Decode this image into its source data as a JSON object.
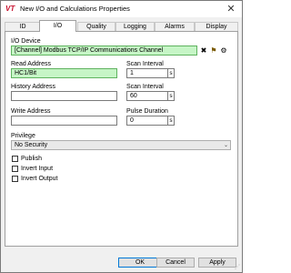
{
  "window": {
    "title": "New I/O and Calculations Properties",
    "app_icon": "VT"
  },
  "tabs": [
    {
      "label": "ID"
    },
    {
      "label": "I/O"
    },
    {
      "label": "Quality"
    },
    {
      "label": "Logging"
    },
    {
      "label": "Alarms"
    },
    {
      "label": "Display"
    }
  ],
  "io": {
    "device_label": "I/O Device",
    "device_value": "[Channel]    Modbus TCP/IP Communications Channel",
    "read_label": "Read Address",
    "read_value": "HC1/Bit",
    "scan1_label": "Scan Interval",
    "scan1_value": "1",
    "scan1_unit": "s",
    "history_label": "History Address",
    "history_value": "",
    "scan2_label": "Scan Interval",
    "scan2_value": "60",
    "scan2_unit": "s",
    "write_label": "Write Address",
    "write_value": "",
    "pulse_label": "Pulse Duration",
    "pulse_value": "0",
    "pulse_unit": "s",
    "privilege_label": "Privilege",
    "privilege_value": "No Security",
    "publish_label": "Publish",
    "invert_input_label": "Invert Input",
    "invert_output_label": "Invert Output"
  },
  "footer": {
    "ok": "OK",
    "cancel": "Cancel",
    "apply": "Apply"
  },
  "colors": {
    "field_green": "#c6f5c6",
    "brand_red": "#c8102e"
  }
}
